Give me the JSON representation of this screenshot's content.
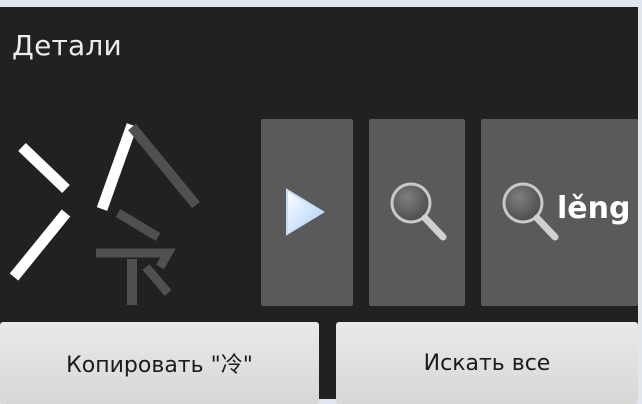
{
  "header": {
    "title": "Детали"
  },
  "character": {
    "glyph": "冷"
  },
  "actions": {
    "play_icon": "play-icon",
    "search_icon": "search-icon",
    "pinyin": "lěng"
  },
  "buttons": {
    "copy_label": "Копировать \"冷\"",
    "search_all_label": "Искать все"
  }
}
